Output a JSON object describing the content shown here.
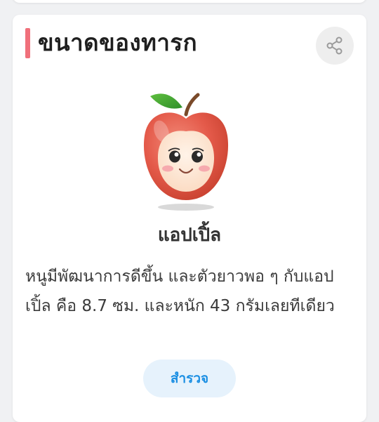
{
  "card": {
    "title": "ขนาดของทารก",
    "fruit_name": "แอปเปิ้ล",
    "description": "หนูมีพัฒนาการดีขึ้น และตัวยาวพอ ๆ กับแอปเปิ้ล คือ 8.7 ซม. และหนัก 43 กรัมเลยทีเดียว",
    "explore_label": "สำรวจ",
    "illustration_icon": "apple-mascot-icon"
  },
  "colors": {
    "accent_bar": "#f0707b",
    "button_bg": "#e6f2fc",
    "button_text": "#1b8fe3",
    "apple_red": "#e45a4a"
  }
}
